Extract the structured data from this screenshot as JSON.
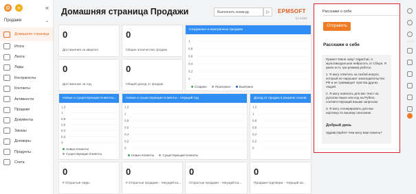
{
  "sidebar": {
    "section": "Продажи",
    "items": [
      {
        "label": "Домашняя страница",
        "active": true
      },
      {
        "label": "Итоги"
      },
      {
        "label": "Лента"
      },
      {
        "label": "Лиды"
      },
      {
        "label": "Контрагенты"
      },
      {
        "label": "Контакты"
      },
      {
        "label": "Активности"
      },
      {
        "label": "Продажи"
      },
      {
        "label": "Документы"
      },
      {
        "label": "Заказы"
      },
      {
        "label": "Договоры"
      },
      {
        "label": "Продукты"
      },
      {
        "label": "Счета"
      }
    ]
  },
  "header": {
    "title": "Домашняя страница Продажи",
    "command_placeholder": "Выполнить команду",
    "logo": "EPMSOFT",
    "version": "8.1.0.6265"
  },
  "tiles": {
    "t1": {
      "value": "0",
      "caption": "Достижения за квартал"
    },
    "t2": {
      "value": "0",
      "caption": "Общее количество продаж"
    },
    "t3": {
      "value": "0",
      "caption": "Достижение за год"
    },
    "t4": {
      "value": "0",
      "caption": "Общий доход от продаж"
    },
    "b1": {
      "value": "0",
      "caption": "# Открытые лиды"
    },
    "b2": {
      "value": "0",
      "caption": "# Открытые продажи - текущий ка..."
    },
    "b3": {
      "value": "0",
      "caption": "Открытые продажи - текущий ка..."
    },
    "b4": {
      "value": "0",
      "caption": "Продажи подтверж - текущий ка..."
    }
  },
  "charts": {
    "c1": {
      "title": "Созданные и выигранные продажи",
      "legend": [
        "Создано",
        "Проиграно",
        "Выиграно"
      ]
    },
    "c2": {
      "title": "Новые и существующие Клиенты...",
      "legend": [
        "Новые Клиенты",
        "Существующие Клиенты"
      ]
    },
    "c3": {
      "title": "Новые и существующие Клиенты - текущий год",
      "legend": [
        "Новые Клиенты",
        "Существующие Клиенты"
      ]
    },
    "c4": {
      "title": "Доход от продаж в разрезе этапов"
    }
  },
  "colors": {
    "accent": "#f07b22",
    "chart_header": "#2f8ef3",
    "panel_border": "#e0202a",
    "series1": "#3aa757",
    "series2": "#9aa0a6",
    "series3": "#1f5fbf"
  },
  "chart_data": [
    {
      "type": "line",
      "title": "Созданные и выигранные продажи",
      "ticks": [
        "1",
        "0,8",
        "0,6",
        "0,4",
        "0,2",
        "0"
      ],
      "series": [
        {
          "name": "Создано",
          "values": []
        },
        {
          "name": "Проиграно",
          "values": []
        },
        {
          "name": "Выиграно",
          "values": []
        }
      ]
    },
    {
      "type": "line",
      "title": "Новые и существующие Клиенты...",
      "ticks": [
        "1,2",
        "1",
        "0,8",
        "0,6",
        "0,4",
        "0,2",
        "0"
      ],
      "series": [
        {
          "name": "Новые Клиенты",
          "values": []
        },
        {
          "name": "Существующие Клиенты",
          "values": []
        }
      ]
    },
    {
      "type": "line",
      "title": "Новые и существующие Клиенты - текущий год",
      "ticks": [
        "1,2",
        "1",
        "0,8",
        "0,6",
        "0,4",
        "0,2",
        "0"
      ],
      "series": [
        {
          "name": "Новые Клиенты",
          "values": []
        },
        {
          "name": "Существующие Клиенты",
          "values": []
        }
      ]
    },
    {
      "type": "bar",
      "title": "Доход от продаж в разрезе этапов",
      "ticks": [
        "1,2",
        "1",
        "0,8",
        "0,6",
        "0,4",
        "0,2",
        "0"
      ],
      "values": []
    }
  ],
  "panel": {
    "input_value": "Расскажи о себе",
    "send_label": "Отправить",
    "heading": "Расскажи о себе",
    "message": [
      "Привет! Меня зовут GigaChat, я мультимодальная нейросеть от Сбера. Я умею есть три режима работы:",
      "1. Я могу ответить на любой вопрос, который не нарушает законодательство РФ и не травмирует чувства других людей.",
      "2. Я могу написать для вас текст на русском языке или код на Python, соответствующий вашим запросам.",
      "3. Я могу сгенерировать для вас картинку по вашему описанию."
    ],
    "greeting_title": "Добрый день",
    "greeting_text": "Здравствуйте! Чем могу вам помочь?"
  }
}
